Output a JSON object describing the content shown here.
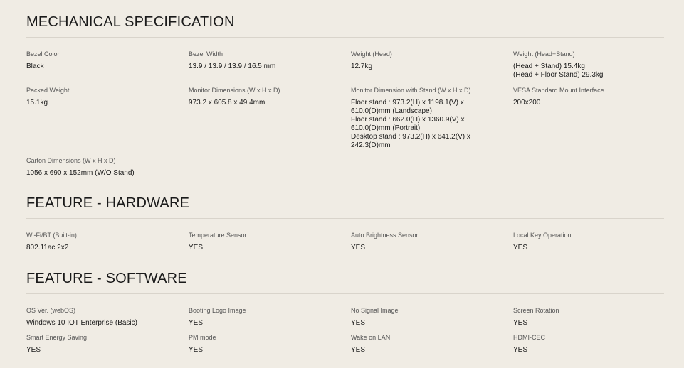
{
  "sections": [
    {
      "title": "MECHANICAL SPECIFICATION",
      "rows": [
        [
          {
            "label": "Bezel Color",
            "value": "Black"
          },
          {
            "label": "Bezel Width",
            "value": "13.9 / 13.9 / 13.9 / 16.5 mm"
          },
          {
            "label": "Weight (Head)",
            "value": "12.7kg"
          },
          {
            "label": "Weight (Head+Stand)",
            "value": "(Head + Stand) 15.4kg\n(Head + Floor Stand) 29.3kg"
          }
        ],
        [
          {
            "label": "Packed Weight",
            "value": "15.1kg"
          },
          {
            "label": "Monitor Dimensions (W x H x D)",
            "value": "973.2 x 605.8 x 49.4mm"
          },
          {
            "label": "Monitor Dimension with Stand (W x H x D)",
            "value": "Floor stand : 973.2(H) x 1198.1(V) x\n610.0(D)mm (Landscape)\nFloor stand : 662.0(H) x 1360.9(V) x\n610.0(D)mm (Portrait)\nDesktop stand : 973.2(H) x 641.2(V) x\n242.3(D)mm"
          },
          {
            "label": "VESA Standard Mount Interface",
            "value": "200x200"
          }
        ],
        [
          {
            "label": "Carton Dimensions (W x H x D)",
            "value": "1056 x 690 x 152mm (W/O Stand)"
          }
        ]
      ]
    },
    {
      "title": "FEATURE - HARDWARE",
      "rows": [
        [
          {
            "label": "Wi-Fi/BT (Built-in)",
            "value": "802.11ac 2x2"
          },
          {
            "label": "Temperature Sensor",
            "value": "YES"
          },
          {
            "label": "Auto Brightness Sensor",
            "value": "YES"
          },
          {
            "label": "Local Key Operation",
            "value": "YES"
          }
        ]
      ]
    },
    {
      "title": "FEATURE - SOFTWARE",
      "rows": [
        [
          {
            "label": "OS Ver. (webOS)",
            "value": "Windows 10 IOT Enterprise (Basic)"
          },
          {
            "label": "Booting Logo Image",
            "value": "YES"
          },
          {
            "label": "No Signal Image",
            "value": "YES"
          },
          {
            "label": "Screen Rotation",
            "value": "YES"
          }
        ],
        [
          {
            "label": "Smart Energy Saving",
            "value": "YES"
          },
          {
            "label": "PM mode",
            "value": "YES"
          },
          {
            "label": "Wake on LAN",
            "value": "YES"
          },
          {
            "label": "HDMI-CEC",
            "value": "YES"
          }
        ]
      ]
    }
  ]
}
